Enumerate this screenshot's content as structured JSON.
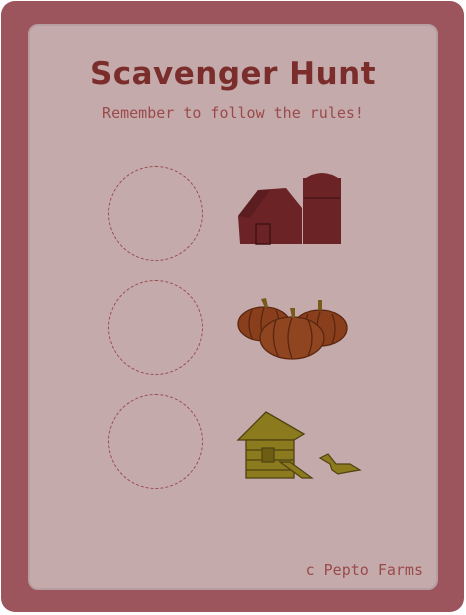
{
  "card": {
    "title": "Scavenger Hunt",
    "subtitle": "Remember to follow the rules!",
    "credit": "c Pepto Farms"
  },
  "items": [
    {
      "icon": "barn-icon",
      "color": "#6b2326"
    },
    {
      "icon": "pumpkins-icon",
      "color": "#8a3f1c"
    },
    {
      "icon": "chicken-coop-icon",
      "color": "#8c7a1e"
    }
  ],
  "colors": {
    "frame": "#9c555c",
    "card": "#c5aaac",
    "text": "#7a2d2a"
  }
}
